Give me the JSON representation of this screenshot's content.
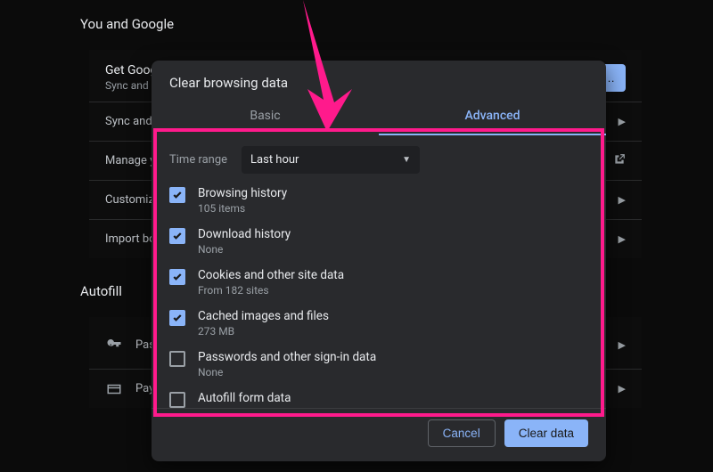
{
  "background": {
    "section1_title": "You and Google",
    "row0_title": "Get Google smarts in Chrome",
    "row0_sub": "Sync and personalize Chrome across your devices",
    "row0_button": "Turn on sync…",
    "row1": "Sync and Google services",
    "row2": "Manage your Google Account",
    "row3": "Customize your Chrome profile",
    "row4": "Import bookmarks and settings",
    "section2_title": "Autofill",
    "autofill_row1": "Passwords",
    "autofill_row2": "Payment methods"
  },
  "modal": {
    "title": "Clear browsing data",
    "tabs": {
      "basic": "Basic",
      "advanced": "Advanced"
    },
    "time_label": "Time range",
    "time_value": "Last hour",
    "items": [
      {
        "title": "Browsing history",
        "sub": "105 items",
        "checked": true
      },
      {
        "title": "Download history",
        "sub": "None",
        "checked": true
      },
      {
        "title": "Cookies and other site data",
        "sub": "From 182 sites",
        "checked": true
      },
      {
        "title": "Cached images and files",
        "sub": "273 MB",
        "checked": true
      },
      {
        "title": "Passwords and other sign-in data",
        "sub": "None",
        "checked": false
      },
      {
        "title": "Autofill form data",
        "sub": "",
        "checked": false
      }
    ],
    "cancel": "Cancel",
    "confirm": "Clear data"
  }
}
